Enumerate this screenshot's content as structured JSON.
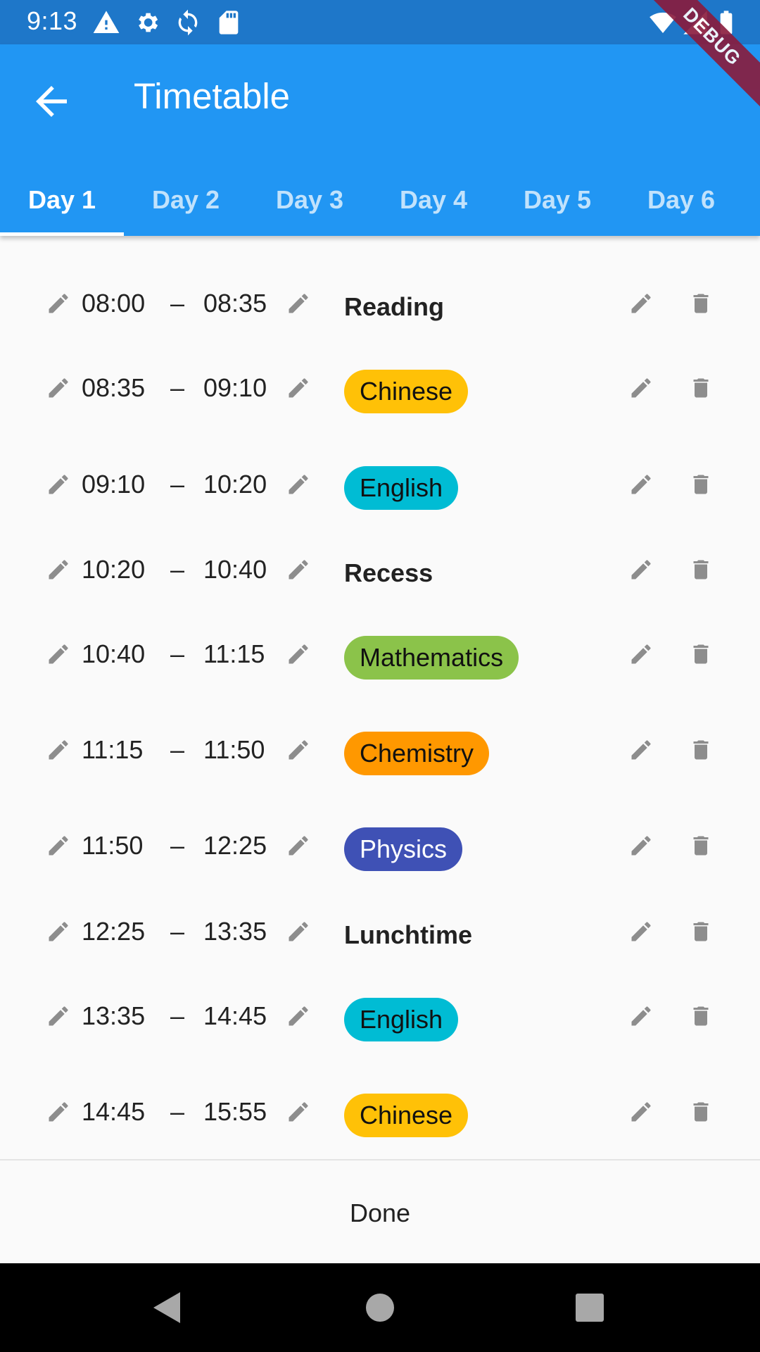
{
  "status_bar": {
    "time": "9:13",
    "icons": [
      "warning-icon",
      "settings-icon",
      "sync-icon",
      "sd-card-icon",
      "wifi-icon",
      "signal-icon",
      "battery-icon"
    ]
  },
  "app_bar": {
    "title": "Timetable",
    "back_icon": "arrow-back-icon",
    "background_color": "#2196f3",
    "debug_banner": "DEBUG"
  },
  "tabs": [
    {
      "label": "Day 1",
      "active": true
    },
    {
      "label": "Day 2",
      "active": false
    },
    {
      "label": "Day 3",
      "active": false
    },
    {
      "label": "Day 4",
      "active": false
    },
    {
      "label": "Day 5",
      "active": false
    },
    {
      "label": "Day 6",
      "active": false
    }
  ],
  "timetable": [
    {
      "start": "08:00",
      "dash": "–",
      "end": "08:35",
      "subject": "Reading",
      "chip_color": null,
      "chip_text_color": null
    },
    {
      "start": "08:35",
      "dash": "–",
      "end": "09:10",
      "subject": "Chinese",
      "chip_color": "#ffc107",
      "chip_text_color": "#111111"
    },
    {
      "start": "09:10",
      "dash": "–",
      "end": "10:20",
      "subject": "English",
      "chip_color": "#00bcd4",
      "chip_text_color": "#111111"
    },
    {
      "start": "10:20",
      "dash": "–",
      "end": "10:40",
      "subject": "Recess",
      "chip_color": null,
      "chip_text_color": null
    },
    {
      "start": "10:40",
      "dash": "–",
      "end": "11:15",
      "subject": "Mathematics",
      "chip_color": "#8bc34a",
      "chip_text_color": "#111111"
    },
    {
      "start": "11:15",
      "dash": "–",
      "end": "11:50",
      "subject": "Chemistry",
      "chip_color": "#ff9800",
      "chip_text_color": "#111111"
    },
    {
      "start": "11:50",
      "dash": "–",
      "end": "12:25",
      "subject": "Physics",
      "chip_color": "#3f51b5",
      "chip_text_color": "#ffffff"
    },
    {
      "start": "12:25",
      "dash": "–",
      "end": "13:35",
      "subject": "Lunchtime",
      "chip_color": null,
      "chip_text_color": null
    },
    {
      "start": "13:35",
      "dash": "–",
      "end": "14:45",
      "subject": "English",
      "chip_color": "#00bcd4",
      "chip_text_color": "#111111"
    },
    {
      "start": "14:45",
      "dash": "–",
      "end": "15:55",
      "subject": "Chinese",
      "chip_color": "#ffc107",
      "chip_text_color": "#111111"
    }
  ],
  "row_icons": {
    "edit": "pencil-icon",
    "delete": "trash-icon"
  },
  "footer": {
    "done_label": "Done"
  },
  "nav_bar": {
    "icons": [
      "back-triangle-icon",
      "home-circle-icon",
      "recents-square-icon"
    ]
  }
}
